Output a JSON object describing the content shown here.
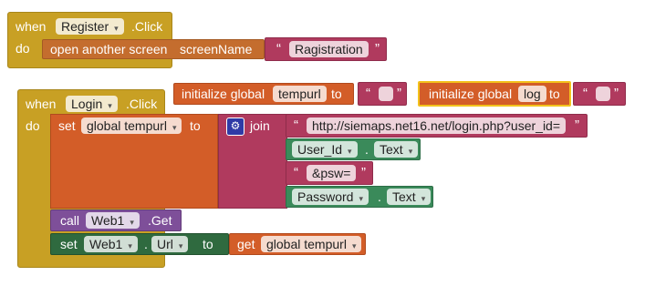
{
  "register_event": {
    "when": "when",
    "component": "Register",
    "event": ".Click",
    "do": "do",
    "open_screen": "open another screen",
    "screen_name_label": "screenName",
    "screen_name_value": "Ragistration"
  },
  "globals": [
    {
      "label": "initialize global",
      "name": "tempurl",
      "to": "to",
      "value": ""
    },
    {
      "label": "initialize global",
      "name": "log",
      "to": "to",
      "value": ""
    }
  ],
  "login_event": {
    "when": "when",
    "component": "Login",
    "event": ".Click",
    "do": "do",
    "set_global": "set",
    "global_name": "global tempurl",
    "to": "to",
    "join": "join",
    "join_items": {
      "url": "http://siemaps.net16.net/login.php?user_id=",
      "user_comp": "User_Id",
      "user_prop": "Text",
      "psw": "&psw=",
      "pass_comp": "Password",
      "pass_prop": "Text"
    },
    "call": "call",
    "call_comp": "Web1",
    "call_method": ".Get",
    "set2": "set",
    "set_comp": "Web1",
    "set_prop": "Url",
    "set_to": "to",
    "get": "get",
    "get_var": "global tempurl"
  },
  "symbols": {
    "dot": ".",
    "caret": "▾",
    "open_quote": "“",
    "close_quote": "”",
    "gear": "⚙"
  }
}
